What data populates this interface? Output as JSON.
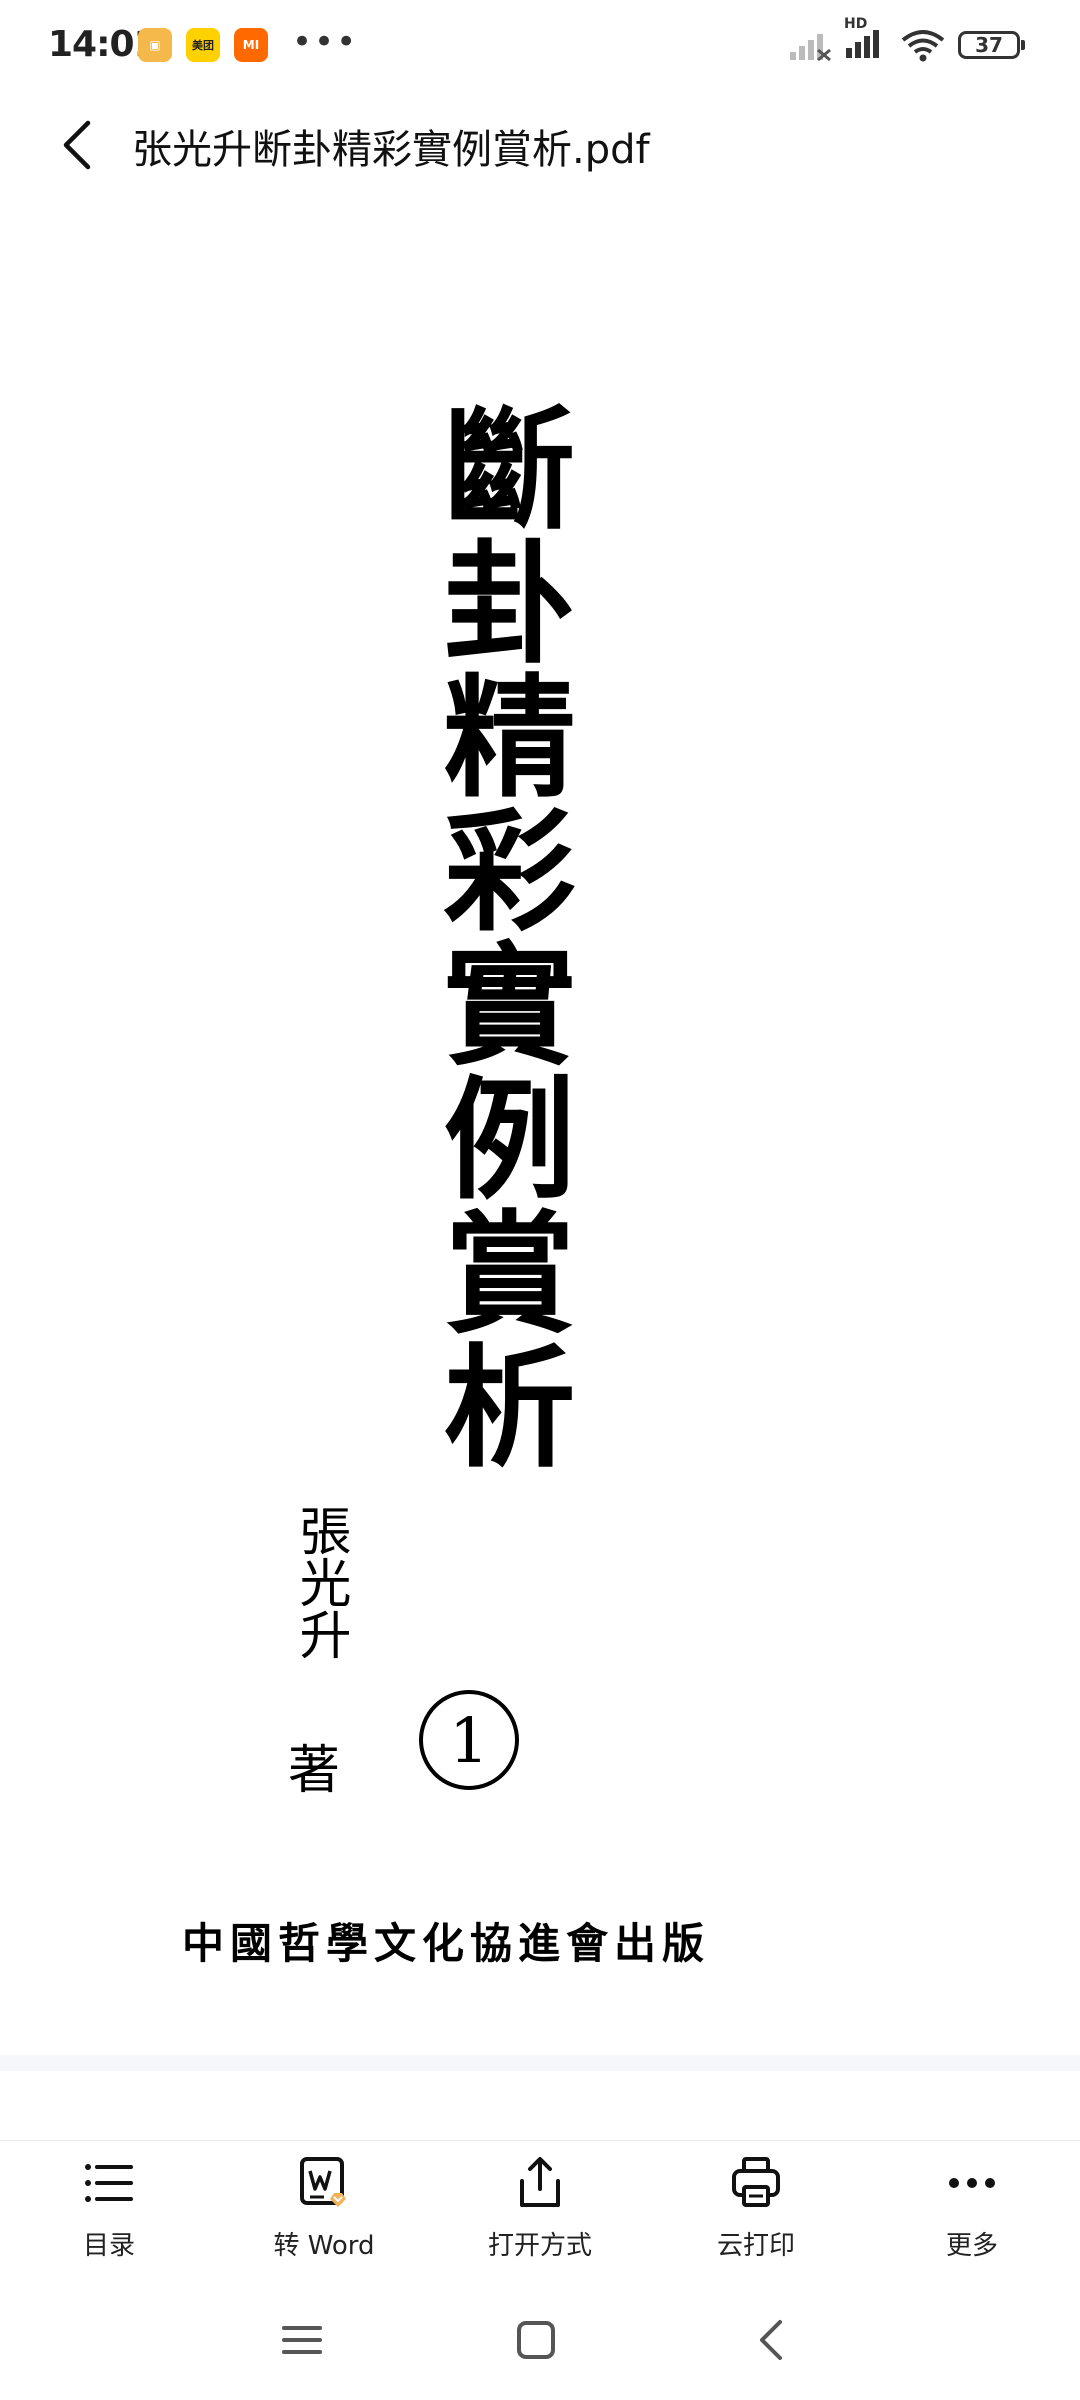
{
  "status_bar": {
    "time": "14:01",
    "notifications": [
      "▣",
      "美团",
      "MI"
    ],
    "more": "•••",
    "network": "HD",
    "battery": "37"
  },
  "header": {
    "title": "张光升断卦精彩實例賞析.pdf"
  },
  "document": {
    "title": "斷卦精彩實例賞析",
    "volume": "1",
    "author": "張光升",
    "author_suffix": "著",
    "publisher": "中國哲學文化協進會出版"
  },
  "toolbar": {
    "items": [
      {
        "label": "目录",
        "icon": "list-icon"
      },
      {
        "label": "转 Word",
        "icon": "word-convert-icon"
      },
      {
        "label": "打开方式",
        "icon": "share-icon"
      },
      {
        "label": "云打印",
        "icon": "printer-icon"
      },
      {
        "label": "更多",
        "icon": "more-icon"
      }
    ]
  },
  "colors": {
    "text": "#111111",
    "vip_accent": "#f0b35a"
  }
}
